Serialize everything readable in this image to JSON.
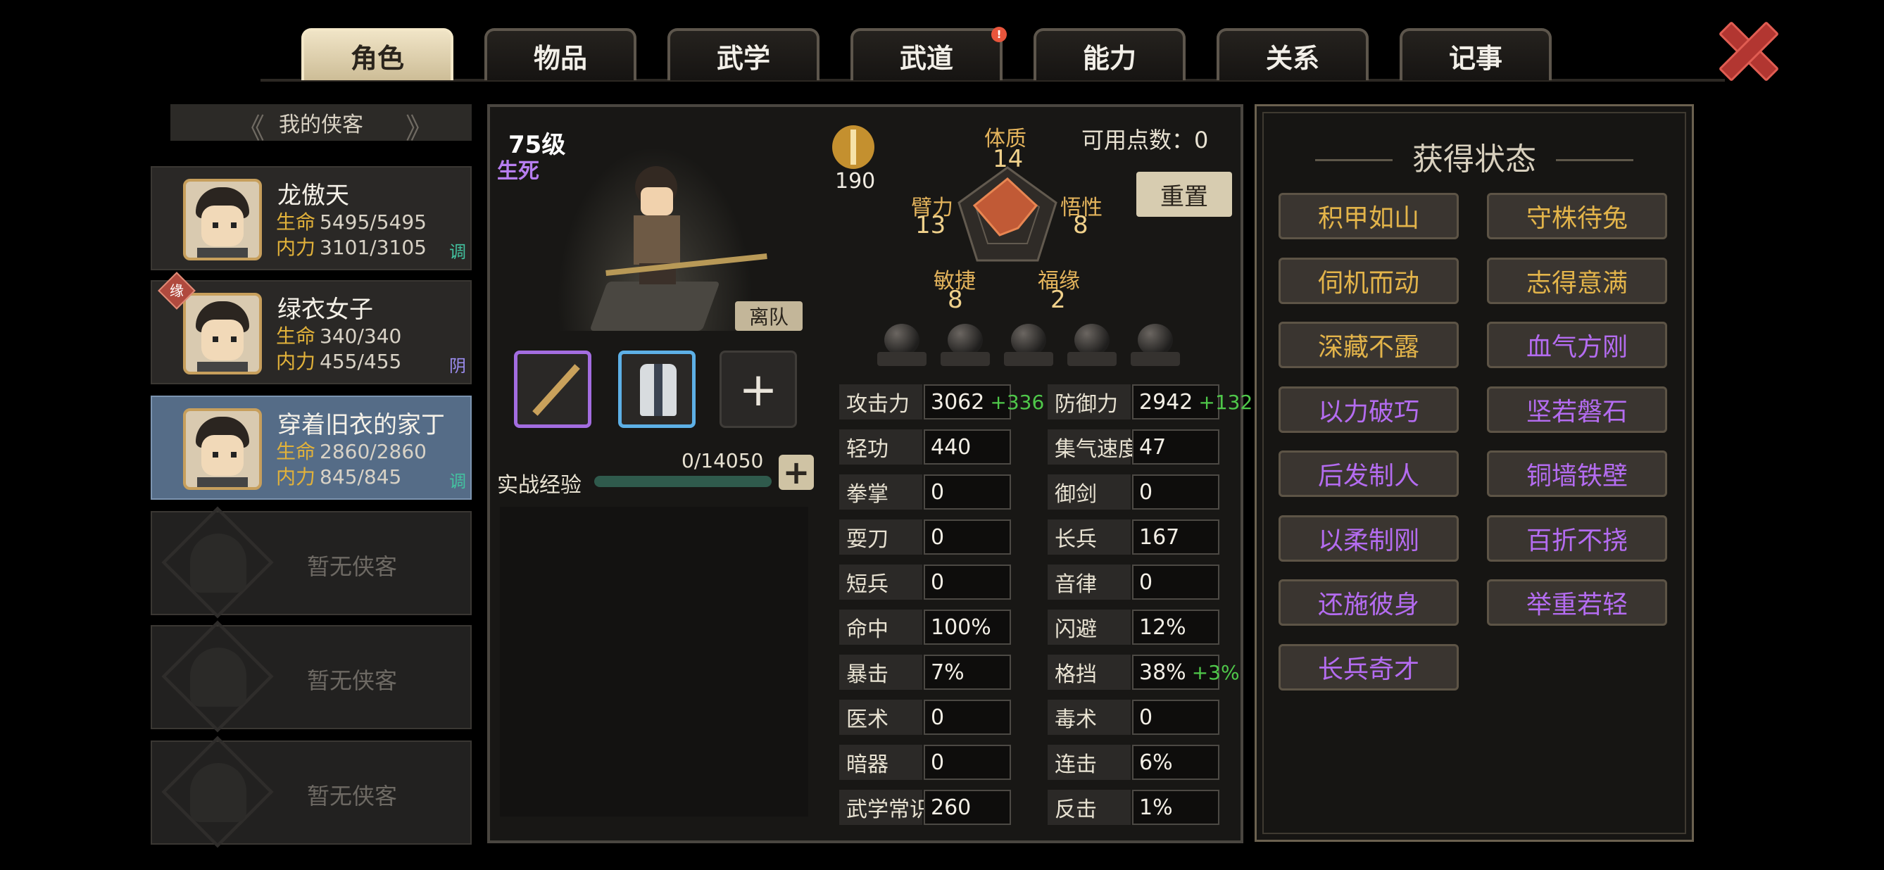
{
  "tabs": [
    {
      "label": "角色",
      "active": true
    },
    {
      "label": "物品"
    },
    {
      "label": "武学"
    },
    {
      "label": "武道",
      "alert": "!"
    },
    {
      "label": "能力"
    },
    {
      "label": "关系"
    },
    {
      "label": "记事"
    }
  ],
  "roster": {
    "header": "我的侠客",
    "heroes": [
      {
        "name": "龙傲天",
        "hp_label": "生命",
        "hp": "5495/5495",
        "mp_label": "内力",
        "mp": "3101/3105",
        "tag": "调",
        "tag_color": "#43c3a0"
      },
      {
        "name": "绿衣女子",
        "hp_label": "生命",
        "hp": "340/340",
        "mp_label": "内力",
        "mp": "455/455",
        "tag": "阴",
        "tag_color": "#9c8df0",
        "bond": "缘"
      },
      {
        "name": "穿着旧衣的家丁",
        "hp_label": "生命",
        "hp": "2860/2860",
        "mp_label": "内力",
        "mp": "845/845",
        "tag": "调",
        "tag_color": "#43c3a0",
        "selected": true
      }
    ],
    "empty_slot_text": "暂无侠客"
  },
  "character": {
    "level": "75级",
    "realm": "生死",
    "leave_label": "离队",
    "power": "190",
    "points_label": "可用点数：0",
    "reset_label": "重置",
    "exp_label": "实战经验",
    "exp_value": "0/14050",
    "exp_plus": "+"
  },
  "attributes": {
    "constitution": {
      "name": "体质",
      "value": "14"
    },
    "strength": {
      "name": "臂力",
      "value": "13"
    },
    "insight": {
      "name": "悟性",
      "value": "8"
    },
    "agility": {
      "name": "敏捷",
      "value": "8"
    },
    "fortune": {
      "name": "福缘",
      "value": "2"
    }
  },
  "stats_left": [
    {
      "label": "攻击力",
      "value": "3062",
      "bonus": "+336"
    },
    {
      "label": "轻功",
      "value": "440"
    },
    {
      "label": "拳掌",
      "value": "0"
    },
    {
      "label": "耍刀",
      "value": "0"
    },
    {
      "label": "短兵",
      "value": "0"
    },
    {
      "label": "命中",
      "value": "100%"
    },
    {
      "label": "暴击",
      "value": "7%"
    },
    {
      "label": "医术",
      "value": "0"
    },
    {
      "label": "暗器",
      "value": "0"
    },
    {
      "label": "武学常识",
      "value": "260"
    }
  ],
  "stats_right": [
    {
      "label": "防御力",
      "value": "2942",
      "bonus": "+132"
    },
    {
      "label": "集气速度",
      "value": "47"
    },
    {
      "label": "御剑",
      "value": "0"
    },
    {
      "label": "长兵",
      "value": "167"
    },
    {
      "label": "音律",
      "value": "0"
    },
    {
      "label": "闪避",
      "value": "12%"
    },
    {
      "label": "格挡",
      "value": "38%",
      "bonus": "+3%"
    },
    {
      "label": "毒术",
      "value": "0"
    },
    {
      "label": "连击",
      "value": "6%"
    },
    {
      "label": "反击",
      "value": "1%"
    }
  ],
  "status_panel": {
    "title": "获得状态",
    "badges": [
      {
        "label": "积甲如山",
        "color": "#e3b44a"
      },
      {
        "label": "守株待兔",
        "color": "#e3b44a"
      },
      {
        "label": "伺机而动",
        "color": "#e3b44a"
      },
      {
        "label": "志得意满",
        "color": "#e3b44a"
      },
      {
        "label": "深藏不露",
        "color": "#e3b44a"
      },
      {
        "label": "血气方刚",
        "color": "#b46cf0"
      },
      {
        "label": "以力破巧",
        "color": "#b46cf0"
      },
      {
        "label": "坚若磐石",
        "color": "#b46cf0"
      },
      {
        "label": "后发制人",
        "color": "#b46cf0"
      },
      {
        "label": "铜墙铁壁",
        "color": "#b46cf0"
      },
      {
        "label": "以柔制刚",
        "color": "#b46cf0"
      },
      {
        "label": "百折不挠",
        "color": "#b46cf0"
      },
      {
        "label": "还施彼身",
        "color": "#b46cf0"
      },
      {
        "label": "举重若轻",
        "color": "#b46cf0"
      },
      {
        "label": "长兵奇才",
        "color": "#b46cf0"
      }
    ]
  },
  "icons": {
    "close": "close-x-icon",
    "power": "sword-medal-icon",
    "orb": "inner-energy-orb-icon"
  }
}
